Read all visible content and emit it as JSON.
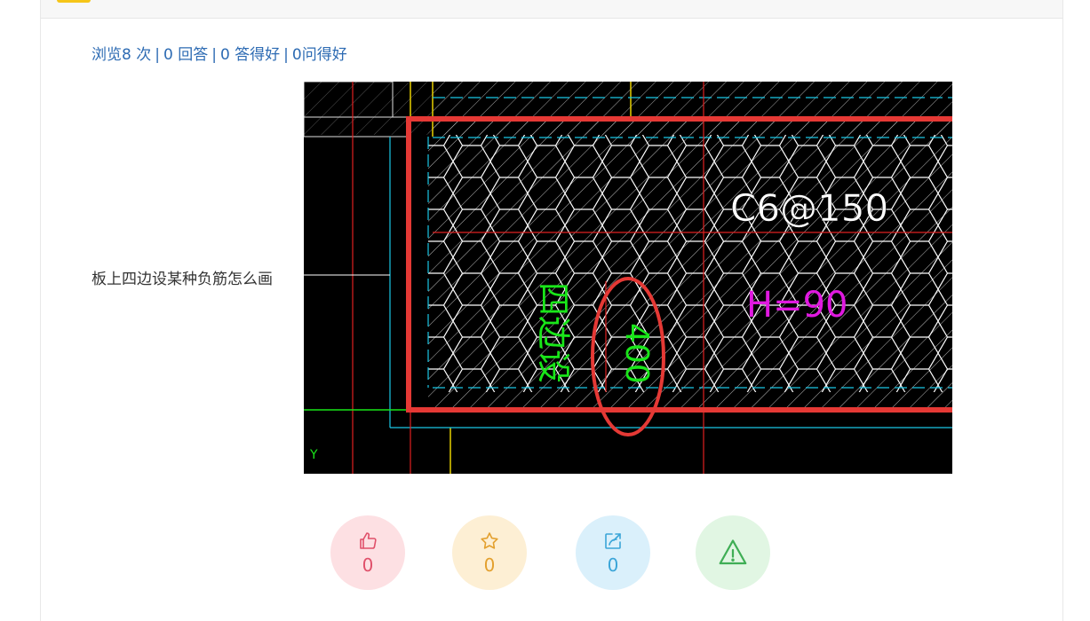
{
  "stats": {
    "views": "浏览8 次",
    "answers": "0 回答",
    "good_answers": "0 答得好",
    "good_questions": "0问得好",
    "separator": "|"
  },
  "question": {
    "title": "板上四边设某种负筋怎么画"
  },
  "image": {
    "annotations": {
      "rebar_label": "C6@150",
      "height_label": "H=90",
      "dim_label": "400",
      "rotated_label": "四边设",
      "axis_label": "Y"
    }
  },
  "actions": {
    "like": {
      "icon": "thumbs-up-icon",
      "count": "0",
      "color": "#e0506a"
    },
    "favorite": {
      "icon": "star-icon",
      "count": "0",
      "color": "#e3a02e"
    },
    "share": {
      "icon": "share-icon",
      "count": "0",
      "color": "#3aa5d8"
    },
    "report": {
      "icon": "warning-icon",
      "color": "#3fae55"
    }
  }
}
